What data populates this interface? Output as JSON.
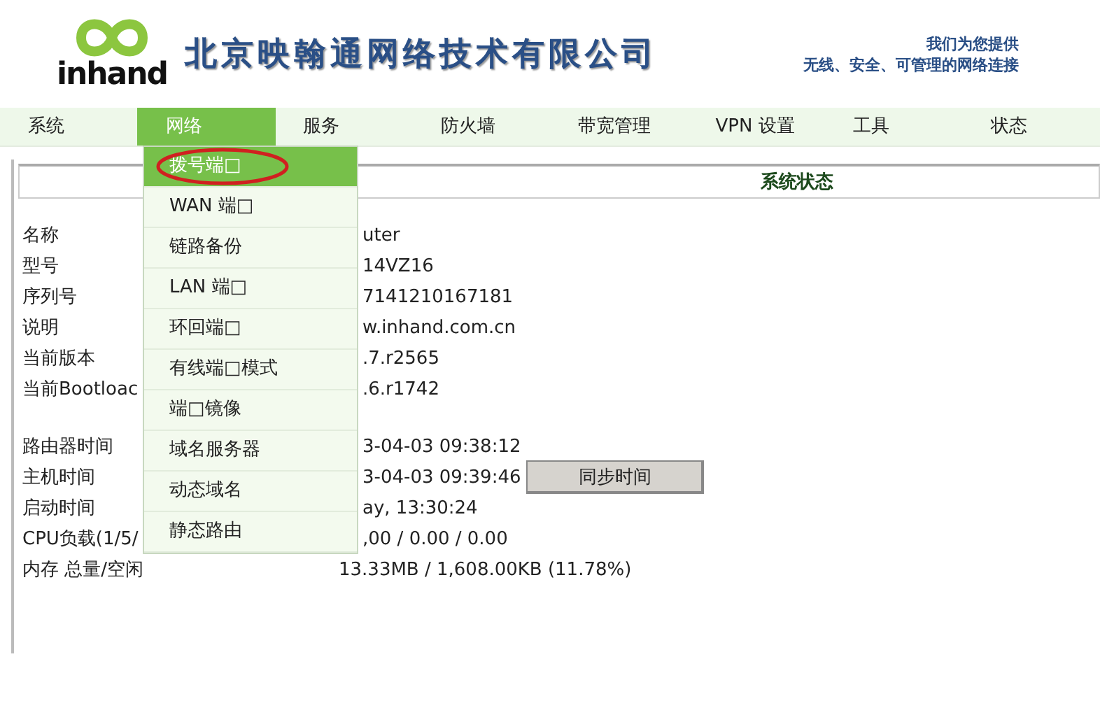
{
  "header": {
    "logo_text": "inhand",
    "company": "北京映翰通网络技术有限公司",
    "slogan_line_1": "我们为您提供",
    "slogan_line_2": "无线、安全、可管理的网络连接"
  },
  "nav": [
    {
      "label": "系统",
      "selected": false
    },
    {
      "label": "网络",
      "selected": true
    },
    {
      "label": "服务",
      "selected": false
    },
    {
      "label": "防火墙",
      "selected": false
    },
    {
      "label": "带宽管理",
      "selected": false
    },
    {
      "label": "VPN 设置",
      "selected": false
    },
    {
      "label": "工具",
      "selected": false
    },
    {
      "label": "状态",
      "selected": false
    }
  ],
  "dropdown": [
    {
      "label": "拨号端□",
      "selected": true,
      "circled": true
    },
    {
      "label": "WAN 端□",
      "selected": false,
      "circled": false
    },
    {
      "label": "链路备份",
      "selected": false,
      "circled": false
    },
    {
      "label": "LAN 端□",
      "selected": false,
      "circled": false
    },
    {
      "label": "环回端□",
      "selected": false,
      "circled": false
    },
    {
      "label": "有线端□模式",
      "selected": false,
      "circled": false
    },
    {
      "label": "端□镜像",
      "selected": false,
      "circled": false
    },
    {
      "label": "域名服务器",
      "selected": false,
      "circled": false
    },
    {
      "label": "动态域名",
      "selected": false,
      "circled": false
    },
    {
      "label": "静态路由",
      "selected": false,
      "circled": false
    }
  ],
  "panel_title": "系统状态",
  "groups": [
    [
      {
        "label": "名称",
        "value": "uter",
        "kind": "partial"
      },
      {
        "label": "型号",
        "value": "14VZ16",
        "kind": "partial"
      },
      {
        "label": "序列号",
        "value": "7141210167181",
        "kind": "partial"
      },
      {
        "label": "说明",
        "value": "w.inhand.com.cn",
        "kind": "partial"
      },
      {
        "label": "当前版本",
        "value": ".7.r2565",
        "kind": "partial"
      },
      {
        "label": "当前Bootloac",
        "value": ".6.r1742",
        "kind": "partial"
      }
    ],
    [
      {
        "label": "路由器时间",
        "value": "3-04-03 09:38:12",
        "kind": "partial"
      },
      {
        "label": "主机时间",
        "value": "3-04-03 09:39:46",
        "kind": "partial",
        "button": "同步时间"
      },
      {
        "label": "启动时间",
        "value": "ay, 13:30:24",
        "kind": "partial"
      },
      {
        "label": "CPU负载(1/5/",
        "value": ",00 / 0.00 / 0.00",
        "kind": "partial"
      },
      {
        "label": "内存 总量/空闲",
        "value": "13.33MB / 1,608.00KB (11.78%)",
        "kind": "full"
      }
    ]
  ]
}
